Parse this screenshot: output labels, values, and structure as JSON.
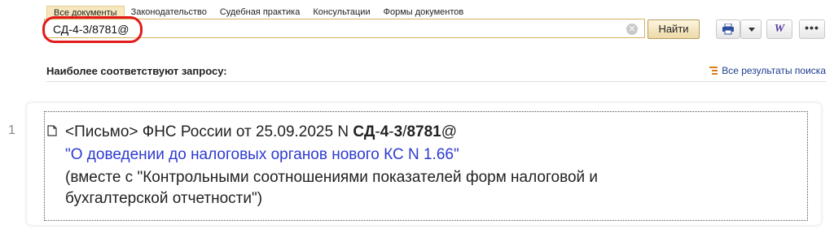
{
  "tabs": [
    {
      "label": "Все документы",
      "active": true
    },
    {
      "label": "Законодательство",
      "active": false
    },
    {
      "label": "Судебная практика",
      "active": false
    },
    {
      "label": "Консультации",
      "active": false
    },
    {
      "label": "Формы документов",
      "active": false
    }
  ],
  "search": {
    "value": "СД-4-3/8781@",
    "button_label": "Найти"
  },
  "toolbar": {
    "word_label": "W",
    "more_label": "•••"
  },
  "section": {
    "title": "Наиболее соответствуют запросу:",
    "all_results": "Все результаты поиска"
  },
  "result": {
    "number": "1",
    "line1_prefix": "<Письмо> ФНС России от 25.09.2025 N ",
    "line1_p1": "СД",
    "line1_d1": "-",
    "line1_p2": "4",
    "line1_d2": "-",
    "line1_p3": "3",
    "line1_d3": "/",
    "line1_p4": "8781",
    "line1_suffix": "@",
    "title": "\"О доведении до налоговых органов нового КС N 1.66\"",
    "note_line1": "(вместе с \"Контрольными соотношениями показателей форм налоговой и",
    "note_line2": "бухгалтерской отчетности\")"
  },
  "colors": {
    "accent": "#d6b25e",
    "link": "#2d3ad0",
    "highlight": "#e21a1a",
    "active_tab": "#f6e7bf"
  }
}
